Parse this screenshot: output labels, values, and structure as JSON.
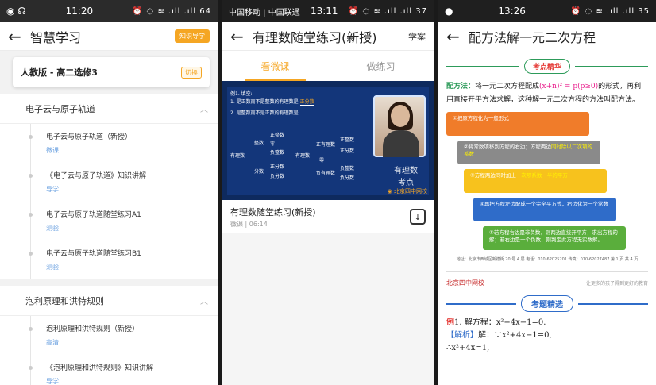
{
  "phone1": {
    "status": {
      "left": "◉ ☊",
      "time": "11:20",
      "right": "⏰ ◌ ≋ .ıll .ıll 64"
    },
    "title": "智慧学习",
    "guide_btn": "知识导学",
    "grade": "人教版 - 高二选修3",
    "grade_badge": "切换",
    "sections": [
      {
        "title": "电子云与原子轨道",
        "items": [
          {
            "name": "电子云与原子轨道（新授）",
            "sub": "微课"
          },
          {
            "name": "《电子云与原子轨道》知识讲解",
            "sub": "导学"
          },
          {
            "name": "电子云与原子轨道随堂练习A1",
            "sub": "测验"
          },
          {
            "name": "电子云与原子轨道随堂练习B1",
            "sub": "测验"
          }
        ]
      },
      {
        "title": "泡利原理和洪特规则",
        "items": [
          {
            "name": "泡利原理和洪特规则（新授）",
            "sub": "高清"
          },
          {
            "name": "《泡利原理和洪特规则》知识讲解",
            "sub": "导学"
          }
        ]
      }
    ]
  },
  "phone2": {
    "status": {
      "left": "中国移动 | 中国联通",
      "time": "13:11",
      "right": "⏰ ◌ ≋ .ıll .ıll 37"
    },
    "title": "有理数随堂练习(新授)",
    "right_link": "学案",
    "tabs": [
      "看微课",
      "做练习"
    ],
    "slide": {
      "line0": "例1. 填空:",
      "line1": "1. 是正数而不是整数的有理数是",
      "blank1": "正分数",
      "line2": "2. 是整数而不是正数的有理数是",
      "tree_a": "有理数",
      "tree_b1": "整数",
      "tree_b2": "分数",
      "tree_c1": "正整数",
      "tree_c2": "零",
      "tree_c3": "负整数",
      "tree_c4": "正分数",
      "tree_c5": "负分数",
      "tree2_a": "有理数",
      "tree2_b1": "正有理数",
      "tree2_b2": "零",
      "tree2_b3": "负有理数",
      "tree2_c1": "正整数",
      "tree2_c2": "正分数",
      "tree2_c3": "负整数",
      "tree2_c4": "负分数"
    },
    "watermark": "有理数\n考点",
    "lesson_title": "有理数随堂练习(新授)",
    "lesson_meta": "微课 | 06:14"
  },
  "phone3": {
    "status": {
      "left": "●",
      "time": "13:26",
      "right": "⏰ ◌ ≋ .ıll .ıll 35"
    },
    "title": "配方法解一元二次方程",
    "kp_label": "考点精华",
    "para_key": "配方法：",
    "para_a": "将一元二次方程配成",
    "para_formula": "(x+n)² = p(p≥0)",
    "para_b": "的形式，再利用直接开平方法求解，这种解一元二次方程的方法叫配方法。",
    "steps": [
      {
        "text": "①把原方程化为一般形式",
        "red": ""
      },
      {
        "text": "②将常数项移到方程的右边；方程两边",
        "red": "同时除以二次项的系数"
      },
      {
        "text": "③方程两边同时加上",
        "red": "一次项系数一半的平方"
      },
      {
        "text": "④再把方程左边配成一个完全平方式，右边化为一个常数",
        "red": ""
      },
      {
        "text": "⑤若方程右边是非负数，则两边直接开平方，求出方程的解；若右边是一个负数，则判定此方程无实数解。",
        "red": ""
      }
    ],
    "step_colors": [
      "#f07c2a",
      "#8a8a8a",
      "#f7c21d",
      "#2f6cc9",
      "#5aae3c"
    ],
    "footer": "地址：北京市西城区新德街 20 号 4 层  电话：010-62025201  传真：010-62027487  第 1 页 共 4 页",
    "band_logo": "北京四中网校",
    "band_text": "让更多的孩子得到更好的教育",
    "jx_label": "考题精选",
    "ex_tag": "例",
    "ex_line1": "1. 解方程：x²+4x−1=0.",
    "ex_jl": "【解析】",
    "ex_line2": "解：∵x²+4x−1=0,",
    "ex_line3": "∴x²+4x=1,"
  }
}
